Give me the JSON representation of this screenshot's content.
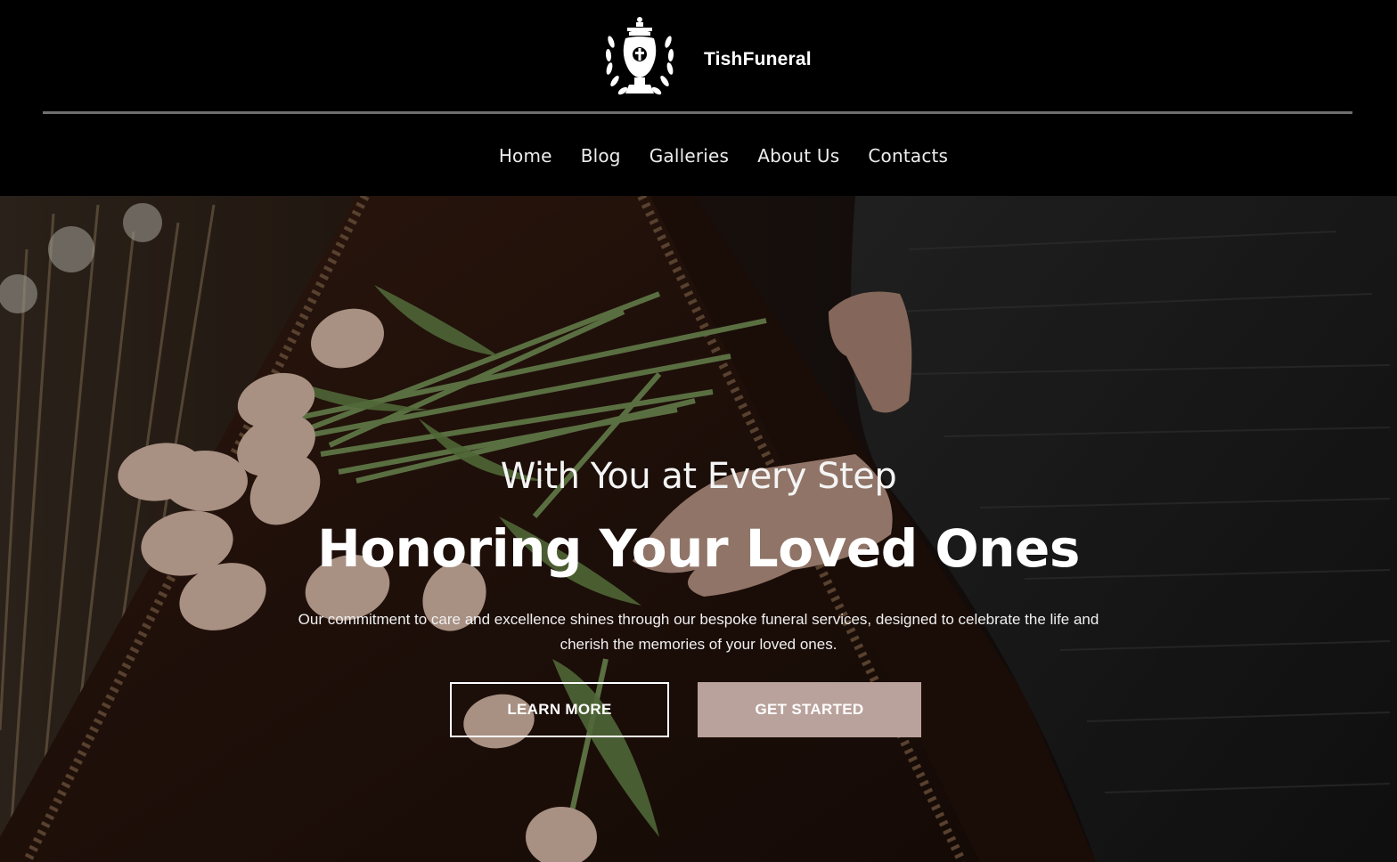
{
  "brand": {
    "name": "TishFuneral",
    "logo_icon": "urn-wreath-icon"
  },
  "nav": {
    "items": [
      "Home",
      "Blog",
      "Galleries",
      "About Us",
      "Contacts"
    ]
  },
  "hero": {
    "eyebrow": "With You at Every Step",
    "headline": "Honoring Your Loved Ones",
    "description": "Our commitment to care and excellence shines through our bespoke funeral services, designed to celebrate the life and cherish the memories of your loved ones.",
    "buttons": {
      "learn_more": "LEARN MORE",
      "get_started": "GET STARTED"
    }
  },
  "colors": {
    "accent": "#b9a29b",
    "background": "#000000",
    "text": "#ffffff"
  }
}
